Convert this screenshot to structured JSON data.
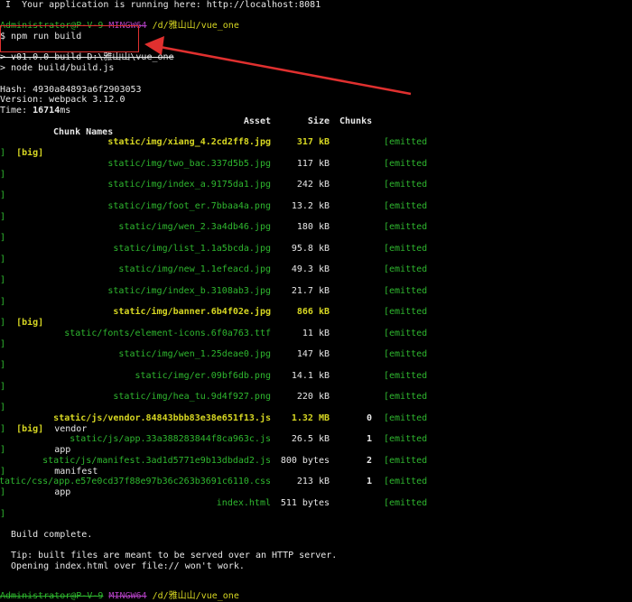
{
  "banner": " I  Your application is running here: http://localhost:8081",
  "prompt1": {
    "user": "Administrator@P-V-9",
    "host": "MINGW64",
    "path": "/d/雅山山/vue_one"
  },
  "command": "$ npm run build",
  "script_line1": "> v01.0.0 build D:\\雅山山\\vue_one",
  "script_line2": "> node build/build.js",
  "hash": "Hash: 4930a84893a6f2903053",
  "version": "Version: webpack 3.12.0",
  "time_label": "Time: ",
  "time_value": "16714",
  "time_unit": "ms",
  "table": {
    "headers": {
      "asset": "Asset",
      "size": "Size",
      "chunks": "Chunks",
      "chunk_names": "Chunk Names"
    },
    "rows": [
      {
        "asset": "static/img/xiang_4.2cd2ff8.jpg",
        "size": "317 kB",
        "chunks": "",
        "status": "[emitted",
        "cont": "]  [big]",
        "big": true
      },
      {
        "asset": "static/img/two_bac.337d5b5.jpg",
        "size": "117 kB",
        "chunks": "",
        "status": "[emitted",
        "cont": "]",
        "big": false
      },
      {
        "asset": "static/img/index_a.9175da1.jpg",
        "size": "242 kB",
        "chunks": "",
        "status": "[emitted",
        "cont": "]",
        "big": false
      },
      {
        "asset": "static/img/foot_er.7bbaa4a.png",
        "size": "13.2 kB",
        "chunks": "",
        "status": "[emitted",
        "cont": "]",
        "big": false
      },
      {
        "asset": "static/img/wen_2.3a4db46.jpg",
        "size": "180 kB",
        "chunks": "",
        "status": "[emitted",
        "cont": "]",
        "big": false
      },
      {
        "asset": "static/img/list_1.1a5bcda.jpg",
        "size": "95.8 kB",
        "chunks": "",
        "status": "[emitted",
        "cont": "]",
        "big": false
      },
      {
        "asset": "static/img/new_1.1efeacd.jpg",
        "size": "49.3 kB",
        "chunks": "",
        "status": "[emitted",
        "cont": "]",
        "big": false
      },
      {
        "asset": "static/img/index_b.3108ab3.jpg",
        "size": "21.7 kB",
        "chunks": "",
        "status": "[emitted",
        "cont": "]",
        "big": false
      },
      {
        "asset": "static/img/banner.6b4f02e.jpg",
        "size": "866 kB",
        "chunks": "",
        "status": "[emitted",
        "cont": "]  [big]",
        "big": true
      },
      {
        "asset": "static/fonts/element-icons.6f0a763.ttf",
        "size": "11 kB",
        "chunks": "",
        "status": "[emitted",
        "cont": "]",
        "big": false
      },
      {
        "asset": "static/img/wen_1.25deae0.jpg",
        "size": "147 kB",
        "chunks": "",
        "status": "[emitted",
        "cont": "]",
        "big": false
      },
      {
        "asset": "static/img/er.09bf6db.png",
        "size": "14.1 kB",
        "chunks": "",
        "status": "[emitted",
        "cont": "]",
        "big": false
      },
      {
        "asset": "static/img/hea_tu.9d4f927.png",
        "size": "220 kB",
        "chunks": "",
        "status": "[emitted",
        "cont": "]",
        "big": false
      },
      {
        "asset": "static/js/vendor.84843bbb83e38e651f13.js",
        "size": "1.32 MB",
        "chunks": "0",
        "status": "[emitted",
        "cont": "]  [big]  vendor",
        "big": true
      },
      {
        "asset": "static/js/app.33a388283844f8ca963c.js",
        "size": "26.5 kB",
        "chunks": "1",
        "status": "[emitted",
        "cont": "]         app",
        "big": false
      },
      {
        "asset": "static/js/manifest.3ad1d5771e9b13dbdad2.js",
        "size": "800 bytes",
        "chunks": "2",
        "status": "[emitted",
        "cont": "]         manifest",
        "big": false
      },
      {
        "asset": "static/css/app.e57e0cd37f88e97b36c263b3691c6110.css",
        "size": "213 kB",
        "chunks": "1",
        "status": "[emitted",
        "cont": "]         app",
        "big": false
      },
      {
        "asset": "index.html",
        "size": "511 bytes",
        "chunks": "",
        "status": "[emitted",
        "cont": "]",
        "big": false
      }
    ]
  },
  "build_complete": "  Build complete.",
  "tip1": "  Tip: built files are meant to be served over an HTTP server.",
  "tip2": "  Opening index.html over file:// won't work.",
  "prompt2": {
    "user": "Administrator@P-V-9",
    "host": "MINGW64",
    "path": "/d/雅山山/vue_one"
  },
  "colors": {
    "green": "#2fb82f",
    "yellow": "#d7d722",
    "magenta": "#b040c0",
    "annotation_red": "#e0302f"
  }
}
